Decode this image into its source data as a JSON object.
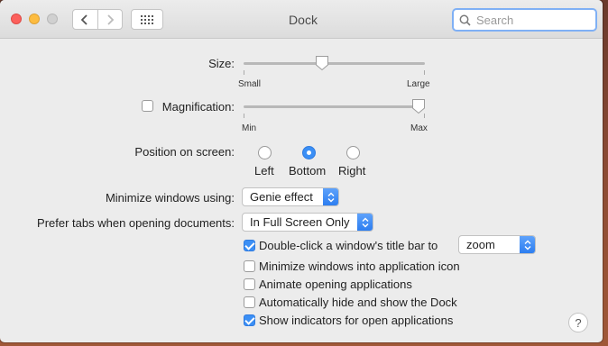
{
  "window": {
    "title": "Dock"
  },
  "toolbar": {
    "back_icon": "chevron-left-icon",
    "forward_icon": "chevron-right-icon",
    "grid_icon": "show-all-grid-icon",
    "search_placeholder": "Search"
  },
  "size": {
    "label": "Size:",
    "min_label": "Small",
    "max_label": "Large",
    "value": 0.42
  },
  "magnification": {
    "label": "Magnification:",
    "checked": false,
    "min_label": "Min",
    "max_label": "Max",
    "value": 1.0
  },
  "position": {
    "label": "Position on screen:",
    "options": [
      "Left",
      "Bottom",
      "Right"
    ],
    "selected": "Bottom"
  },
  "minimize": {
    "label": "Minimize windows using:",
    "value": "Genie effect"
  },
  "prefer_tabs": {
    "label": "Prefer tabs when opening documents:",
    "value": "In Full Screen Only"
  },
  "options": [
    {
      "label": "Double-click a window's title bar to",
      "checked": true
    },
    {
      "label": "Minimize windows into application icon",
      "checked": false
    },
    {
      "label": "Animate opening applications",
      "checked": false
    },
    {
      "label": "Automatically hide and show the Dock",
      "checked": false
    },
    {
      "label": "Show indicators for open applications",
      "checked": true
    }
  ],
  "double_click_action": {
    "value": "zoom"
  },
  "help": {
    "label": "?"
  },
  "colors": {
    "accent": "#3b8ff5",
    "close": "#fc605c",
    "minimize": "#fdbc40"
  }
}
